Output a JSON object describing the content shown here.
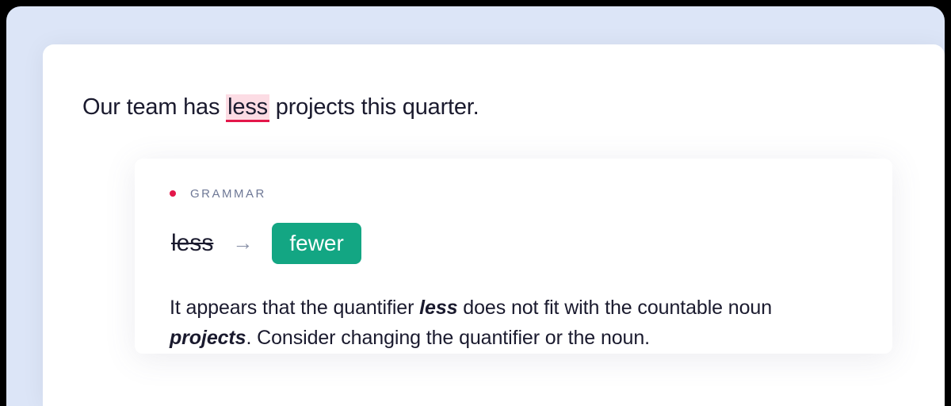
{
  "sentence": {
    "before": "Our team has ",
    "highlighted": "less",
    "after": " projects this quarter."
  },
  "card": {
    "category": "GRAMMAR",
    "incorrect": "less",
    "arrow": "→",
    "correct": "fewer",
    "explanation": {
      "part1": "It appears that the quantifier ",
      "em1": "less",
      "part2": " does not fit with the countable noun ",
      "em2": "projects",
      "part3": ". Consider changing the quantifier or the noun."
    }
  }
}
